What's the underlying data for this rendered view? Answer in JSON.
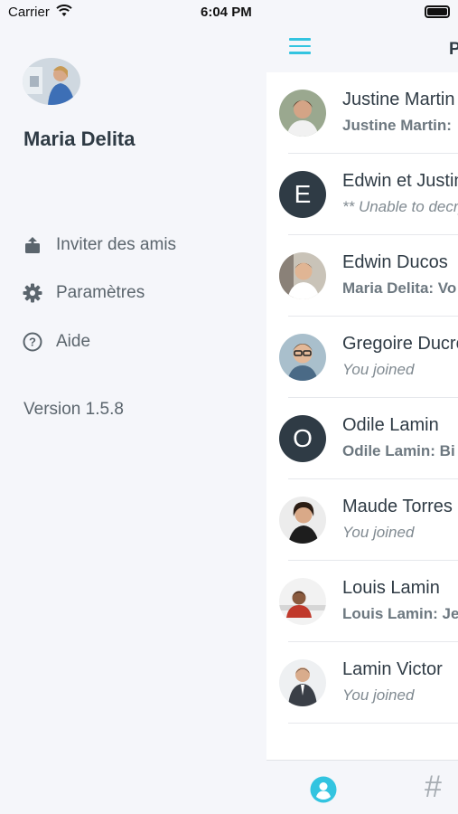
{
  "status_bar": {
    "carrier": "Carrier",
    "time": "6:04 PM"
  },
  "drawer": {
    "user_name": "Maria Delita",
    "menu": [
      {
        "label": "Inviter des amis",
        "icon": "share-icon"
      },
      {
        "label": "Paramètres",
        "icon": "gear-icon"
      },
      {
        "label": "Aide",
        "icon": "help-icon"
      }
    ],
    "version": "Version 1.5.8"
  },
  "panel": {
    "title": "P",
    "conversations": [
      {
        "name": "Justine Martin",
        "preview": "Justine Martin: ",
        "style": "bold",
        "avatar": "photo"
      },
      {
        "name": "Edwin et Justine",
        "preview": "** Unable to decrypt",
        "style": "italic",
        "avatar": "letter",
        "letter": "E"
      },
      {
        "name": "Edwin Ducos",
        "preview": "Maria Delita: Vo",
        "style": "bold",
        "avatar": "photo"
      },
      {
        "name": "Gregoire Ducros",
        "preview": "You joined",
        "style": "italic",
        "avatar": "photo"
      },
      {
        "name": "Odile Lamin",
        "preview": "Odile Lamin: Bi",
        "style": "bold",
        "avatar": "letter",
        "letter": "O"
      },
      {
        "name": "Maude Torres",
        "preview": "You joined",
        "style": "italic",
        "avatar": "photo"
      },
      {
        "name": "Louis Lamin",
        "preview": "Louis Lamin: Je",
        "style": "bold",
        "avatar": "photo"
      },
      {
        "name": "Lamin Victor",
        "preview": "You joined",
        "style": "italic",
        "avatar": "photo"
      }
    ]
  },
  "colors": {
    "accent": "#33c4e0",
    "text_dark": "#2f3b45",
    "letter_avatar_bg": "#2f3b45"
  }
}
